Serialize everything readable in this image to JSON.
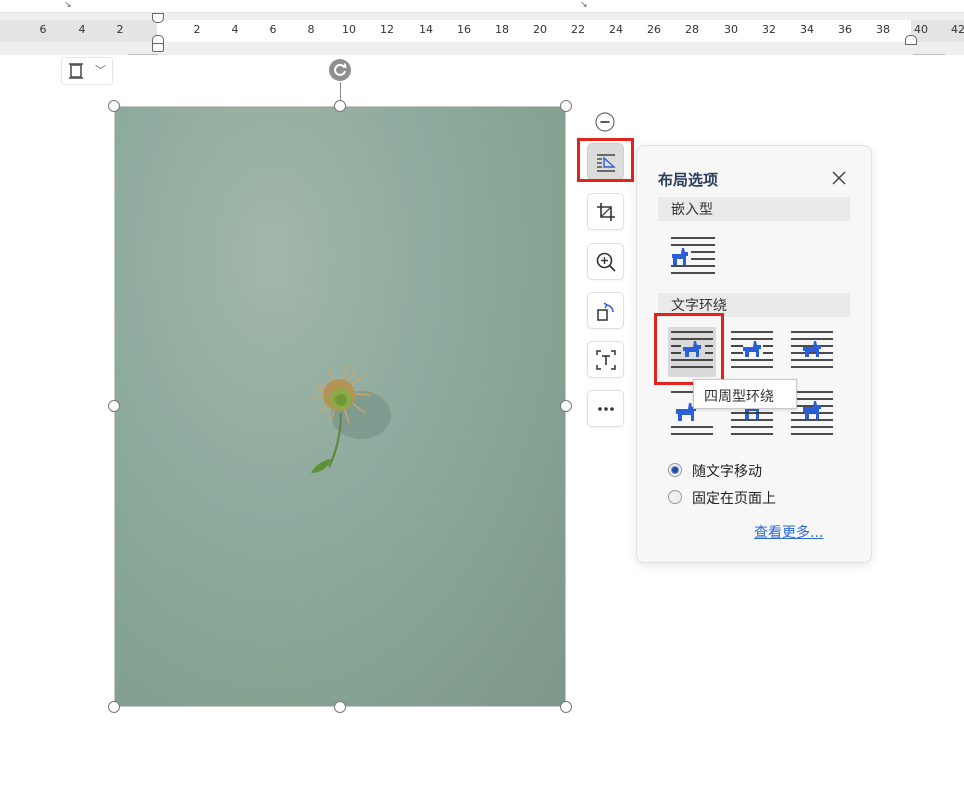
{
  "ruler": {
    "numbers": [
      "6",
      "4",
      "2",
      "2",
      "4",
      "6",
      "8",
      "10",
      "12",
      "14",
      "16",
      "18",
      "20",
      "22",
      "24",
      "26",
      "28",
      "30",
      "32",
      "34",
      "36",
      "38",
      "40",
      "42"
    ]
  },
  "floating_toolbar": {
    "items": [
      {
        "name": "layout-options",
        "icon": "layout-options-icon",
        "active": true
      },
      {
        "name": "crop",
        "icon": "crop-icon"
      },
      {
        "name": "zoom",
        "icon": "zoom-in-icon"
      },
      {
        "name": "rotate",
        "icon": "rotate-icon"
      },
      {
        "name": "extract-text",
        "icon": "extract-text-icon"
      },
      {
        "name": "more",
        "icon": "more-icon"
      }
    ]
  },
  "layout_panel": {
    "title": "布局选项",
    "inline_section": "嵌入型",
    "wrap_section": "文字环绕",
    "tooltip": "四周型环绕",
    "radio_options": [
      {
        "label": "随文字移动",
        "checked": true
      },
      {
        "label": "固定在页面上",
        "checked": false
      }
    ],
    "more_link": "查看更多..."
  },
  "colors": {
    "accent_blue": "#2b5fd8",
    "highlight_red": "#e4231c",
    "photo_green": "#8fab9e"
  }
}
